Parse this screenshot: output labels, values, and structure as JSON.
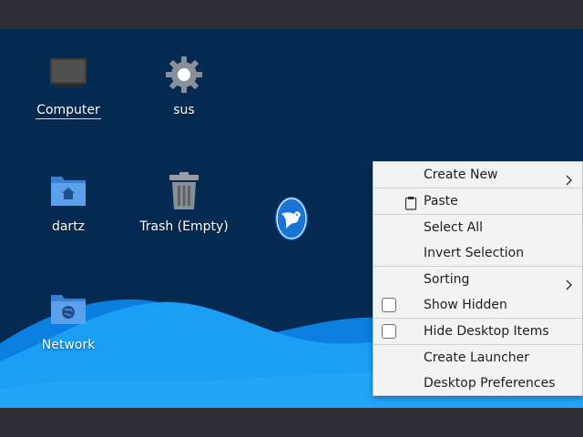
{
  "desktop": {
    "icons": [
      {
        "label": "Computer",
        "icon": "computer-icon"
      },
      {
        "label": "sus",
        "icon": "gear-icon"
      },
      {
        "label": "dartz",
        "icon": "home-folder-icon"
      },
      {
        "label": "Trash (Empty)",
        "icon": "trash-icon"
      },
      {
        "label": "Network",
        "icon": "network-folder-icon"
      }
    ],
    "wallpaper_logo": "bird-logo",
    "colors": {
      "background": "#052b52",
      "wave_light": "#1a9ff5",
      "wave_dark": "#0a7fe0",
      "panel": "#2f2e36"
    }
  },
  "context_menu": {
    "items": [
      {
        "label": "Create New",
        "has_submenu": true
      },
      {
        "label": "Paste",
        "icon": "clipboard-icon"
      },
      {
        "label": "Select All"
      },
      {
        "label": "Invert Selection"
      },
      {
        "label": "Sorting",
        "has_submenu": true
      },
      {
        "label": "Show Hidden",
        "checkbox": false
      },
      {
        "label": "Hide Desktop Items",
        "checkbox": false
      },
      {
        "label": "Create Launcher"
      },
      {
        "label": "Desktop Preferences"
      }
    ]
  }
}
